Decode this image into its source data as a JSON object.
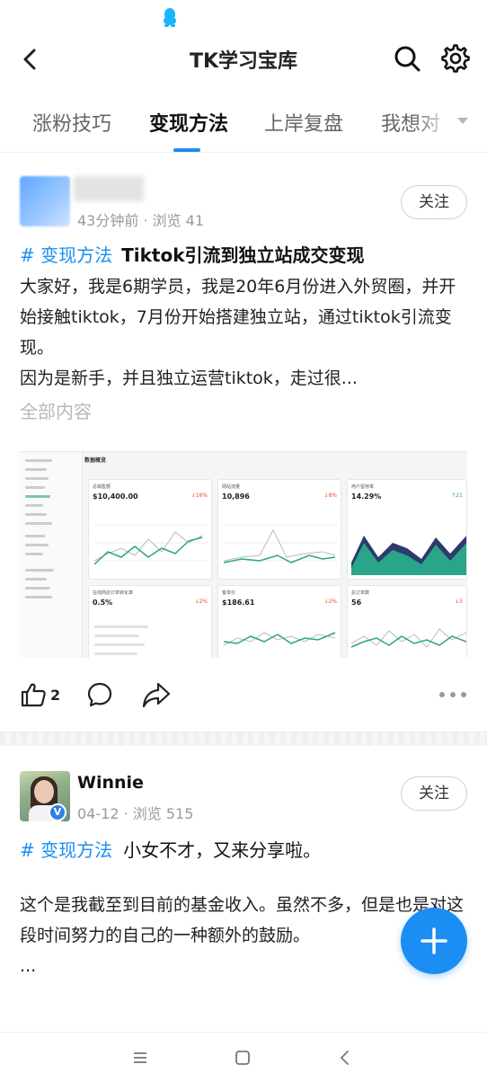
{
  "header": {
    "title": "TK学习宝库"
  },
  "tabs": [
    {
      "label": "涨粉技巧",
      "active": false
    },
    {
      "label": "变现方法",
      "active": true
    },
    {
      "label": "上岸复盘",
      "active": false
    },
    {
      "label": "我想对",
      "active": false
    }
  ],
  "colors": {
    "accent": "#1a8ef2",
    "text": "#222222",
    "muted": "#9a9a9a"
  },
  "posts": [
    {
      "author": "",
      "meta": "43分钟前 · 浏览 41",
      "follow_label": "关注",
      "hashtag": "# 变现方法",
      "title": "Tiktok引流到独立站成交变现",
      "body": "大家好，我是6期学员，我是20年6月份进入外贸圈，并开始接触tiktok，7月份开始搭建独立站，通过tiktok引流变现。\n因为是新手，并且独立运营tiktok，走过很...",
      "expand_label": "全部内容",
      "like_count": "2",
      "dashboard": {
        "title": "数据概览",
        "cards": [
          {
            "label": "总销售额",
            "value": "$10,400.00",
            "delta": "↓16%",
            "trend": "down"
          },
          {
            "label": "网站流量",
            "value": "10,896",
            "delta": "↓8%",
            "trend": "down"
          },
          {
            "label": "用户留存率",
            "value": "14.29%",
            "delta": "↑21",
            "trend": "up"
          },
          {
            "label": "在线商店订单转化率",
            "value": "0.5%",
            "delta": "↓2%",
            "trend": "down"
          },
          {
            "label": "客单价",
            "value": "$186.61",
            "delta": "↓2%",
            "trend": "down"
          },
          {
            "label": "总订单数",
            "value": "56",
            "delta": "↓5",
            "trend": "down"
          }
        ]
      }
    },
    {
      "author": "Winnie",
      "meta": "04-12 · 浏览 515",
      "follow_label": "关注",
      "hashtag": "# 变现方法",
      "title": "小女不才，又来分享啦。",
      "body": "这个是我截至到目前的基金收入。虽然不多，但是也是对这段时间努力的自己的一种额外的鼓励。\n..."
    }
  ],
  "icons": {
    "status": "qq-icon",
    "back": "back-arrow-icon",
    "search": "search-icon",
    "settings": "gear-icon",
    "tab_more": "chevron-down-icon",
    "like": "thumbs-up-icon",
    "comment": "comment-bubble-icon",
    "share": "share-arrow-icon",
    "more": "more-dots-icon",
    "fab": "plus-icon",
    "verified": "verified-badge-icon"
  },
  "verified_badge": "V"
}
